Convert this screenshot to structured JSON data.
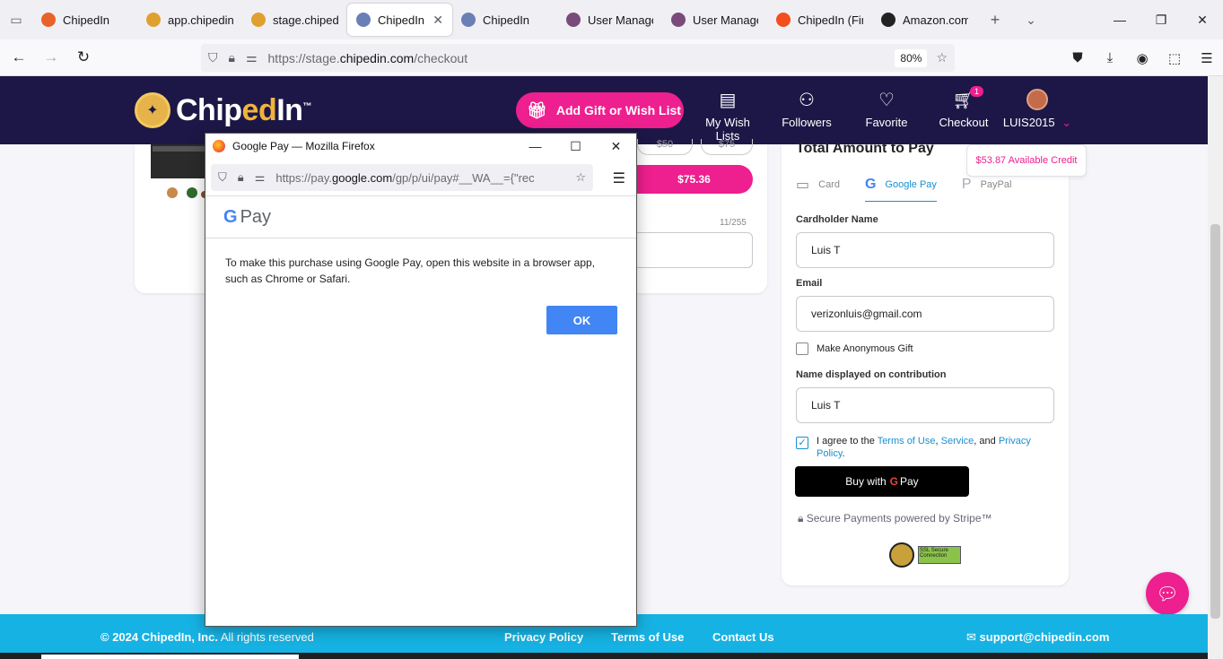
{
  "browser": {
    "tabs": [
      {
        "title": "ChipedIn",
        "fav": "#e8622a"
      },
      {
        "title": "app.chipedin.c",
        "fav": "#e0a030"
      },
      {
        "title": "stage.chipedin",
        "fav": "#e0a030"
      },
      {
        "title": "ChipedIn",
        "fav": "#6a7fb5"
      },
      {
        "title": "ChipedIn",
        "fav": "#6a7fb5"
      },
      {
        "title": "User Managem",
        "fav": "#7a4a7a"
      },
      {
        "title": "User Managem",
        "fav": "#7a4a7a"
      },
      {
        "title": "ChipedIn (Fina",
        "fav": "#f24e1e"
      },
      {
        "title": "Amazon.com:",
        "fav": "#222222"
      }
    ],
    "url_prefix": "https://stage.",
    "url_domain": "chipedin.com",
    "url_path": "/checkout",
    "zoom": "80%"
  },
  "site": {
    "logo_a": "Chip",
    "logo_b": "ed",
    "logo_c": "In",
    "logo_tm": "™",
    "gift_button": "Add Gift or Wish List",
    "nav": {
      "wishlists": "My Wish Lists",
      "followers": "Followers",
      "favorite": "Favorite",
      "checkout": "Checkout",
      "cart_count": "1",
      "user": "LUIS2015"
    }
  },
  "left": {
    "pay_amount": "$75.36",
    "pill_a": "$50",
    "pill_b": "$75",
    "char_count": "11/255"
  },
  "checkout": {
    "title": "Total Amount to Pay",
    "credit": "$53.87 Available Credit",
    "tabs": {
      "card": "Card",
      "gpay": "Google Pay",
      "paypal": "PayPal"
    },
    "cardholder_label": "Cardholder Name",
    "cardholder_value": "Luis T",
    "email_label": "Email",
    "email_value": "verizonluis@gmail.com",
    "anonymous_label": "Make Anonymous Gift",
    "display_label": "Name displayed on contribution",
    "display_value": "Luis T",
    "agree_prefix": "I agree to the ",
    "terms": "Terms of Use",
    "sep1": ", ",
    "service": "Service",
    "sep2": ", and ",
    "privacy": "Privacy Policy",
    "end": ".",
    "buy_prefix": "Buy with",
    "buy_g": "G",
    "buy_suffix": "Pay",
    "secure": "Secure Payments powered by Stripe™",
    "seal_text": "SSL Secure Connection"
  },
  "footer": {
    "copyright_bold": "© 2024 ChipedIn, Inc.",
    "copyright_rest": " All rights reserved",
    "privacy": "Privacy Policy",
    "terms": "Terms of Use",
    "contact": "Contact Us",
    "email": "support@chipedin.com"
  },
  "popup": {
    "window_title": "Google Pay — Mozilla Firefox",
    "url_prefix": "https://pay.",
    "url_domain": "google.com",
    "url_path": "/gp/p/ui/pay#__WA__={\"rec",
    "brand_g": "G",
    "brand_text": "Pay",
    "message": "To make this purchase using Google Pay, open this website in a browser app, such as Chrome or Safari.",
    "ok": "OK"
  }
}
